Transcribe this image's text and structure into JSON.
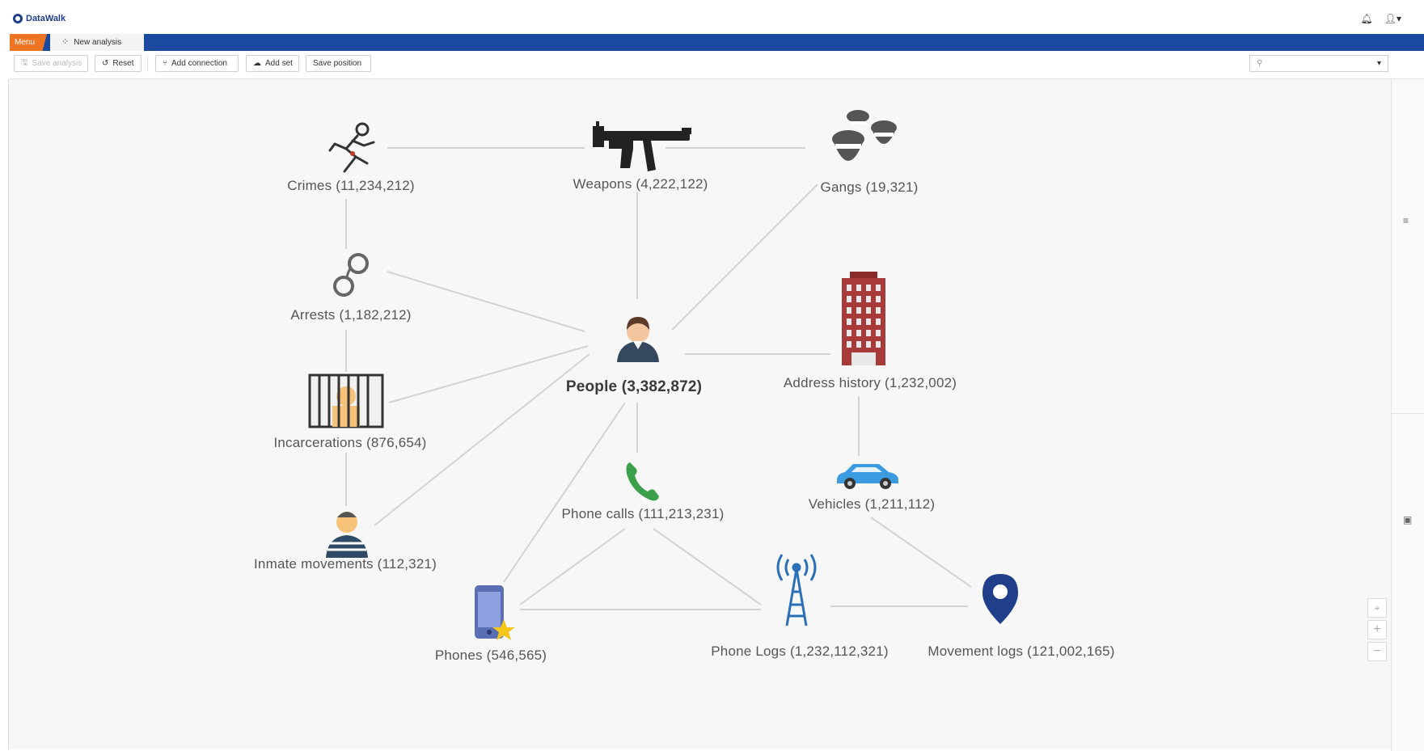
{
  "app": {
    "name": "DataWalk"
  },
  "topbar": {
    "bell_icon": "bell-icon",
    "user_icon": "user-icon"
  },
  "tabs": {
    "menu_label": "Menu",
    "analysis_label": "New analysis"
  },
  "toolbar": {
    "save_analysis": "Save analysis",
    "reset": "Reset",
    "add_connection": "Add connection",
    "add_set": "Add set",
    "save_position": "Save position",
    "search_placeholder": ""
  },
  "graph": {
    "nodes": {
      "crimes": "Crimes (11,234,212)",
      "weapons": "Weapons (4,222,122)",
      "gangs": "Gangs (19,321)",
      "arrests": "Arrests (1,182,212)",
      "people": "People (3,382,872)",
      "address_history": "Address history (1,232,002)",
      "incarcerations": "Incarcerations (876,654)",
      "phone_calls": "Phone calls (111,213,231)",
      "vehicles": "Vehicles (1,211,112)",
      "inmate_movements": "Inmate movements (112,321)",
      "phones": "Phones (546,565)",
      "phone_logs": "Phone Logs (1,232,112,321)",
      "movement_logs": "Movement logs (121,002,165)"
    }
  },
  "colors": {
    "brand": "#1f3f8a",
    "tabbar": "#1a4aa0",
    "menu_tab": "#f07522",
    "edge": "#d0d0d0"
  }
}
